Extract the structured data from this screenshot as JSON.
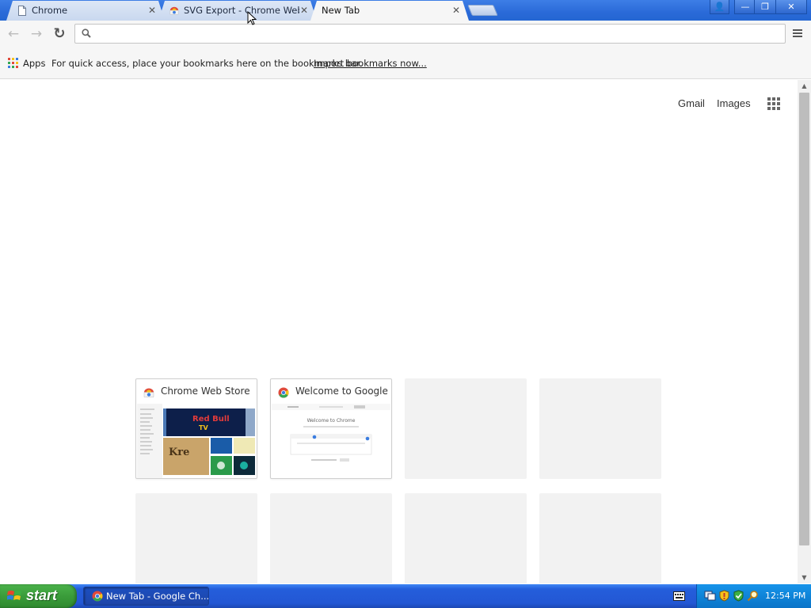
{
  "tabs": [
    {
      "title": "Chrome",
      "close": "✕",
      "icon": "document-icon",
      "active": false
    },
    {
      "title": "SVG Export - Chrome Web Store",
      "close": "✕",
      "icon": "chrome-web-store-icon",
      "active": false
    },
    {
      "title": "New Tab",
      "close": "✕",
      "icon": "none",
      "active": true
    }
  ],
  "window_controls": {
    "profile": "👤",
    "minimize": "—",
    "maximize": "❐",
    "close": "✕"
  },
  "toolbar": {
    "back": "←",
    "forward": "→",
    "reload": "↻",
    "omnibox_value": ""
  },
  "bookmarks_bar": {
    "apps_label": "Apps",
    "hint": "For quick access, place your bookmarks here on the bookmarks bar.",
    "import_link": "Import bookmarks now..."
  },
  "google_bar": {
    "gmail": "Gmail",
    "images": "Images"
  },
  "most_visited": [
    {
      "title": "Chrome Web Store",
      "favicon": "chrome-web-store-icon",
      "filled": true
    },
    {
      "title": "Welcome to Google Chrome",
      "favicon": "chrome-icon",
      "filled": true
    },
    {
      "title": "",
      "filled": false
    },
    {
      "title": "",
      "filled": false
    },
    {
      "title": "",
      "filled": false
    },
    {
      "title": "",
      "filled": false
    },
    {
      "title": "",
      "filled": false
    },
    {
      "title": "",
      "filled": false
    }
  ],
  "thumbnail_welcome": {
    "heading": "Welcome to Chrome"
  },
  "taskbar": {
    "start_label": "start",
    "task_label": "New Tab - Google Ch...",
    "clock": "12:54 PM"
  },
  "colors": {
    "titlebar": "#2a6ad8",
    "taskbar": "#245edb",
    "start_green": "#3a9c3a",
    "tray": "#0f84d8"
  }
}
